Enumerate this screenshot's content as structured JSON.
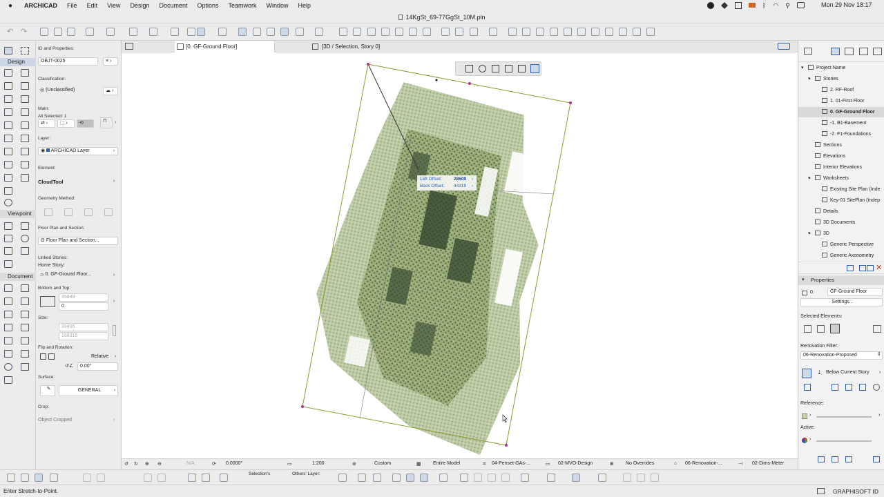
{
  "menubar": {
    "app": "ARCHICAD",
    "items": [
      "File",
      "Edit",
      "View",
      "Design",
      "Document",
      "Options",
      "Teamwork",
      "Window",
      "Help"
    ],
    "datetime": "Mon 29 Nov  18:17"
  },
  "window": {
    "title": "14KgSt_69-77GgSt_10M.pln"
  },
  "tabs": [
    {
      "label": "[0. GF-Ground Floor]"
    },
    {
      "label": "[3D / Selection, Story 0]"
    }
  ],
  "toolbox": {
    "sections": [
      "Design",
      "Viewpoint",
      "Document"
    ]
  },
  "info": {
    "id_label": "ID and Properties:",
    "id_value": "OBJT-0025",
    "classification_label": "Classification:",
    "classification_value": "(Unclassified)",
    "main_label": "Main:",
    "all_selected": "All Selected: 1",
    "layer_label": "Layer:",
    "layer_value": "ARCHICAD Layer",
    "element_label": "Element:",
    "element_value": "CloudTool",
    "geometry_label": "Geometry Method:",
    "floorplan_label": "Floor Plan and Section:",
    "floorplan_value": "Floor Plan and Section...",
    "linked_label": "Linked Stories:",
    "home_label": "Home Story:",
    "home_value": "0. GF-Ground Floor...",
    "bt_label": "Bottom and Top:",
    "bt_top": "35849",
    "bt_bottom": "0",
    "size_label": "Size:",
    "size_w": "99406",
    "size_h": "168315",
    "flip_label": "Flip and Rotation:",
    "relative": "Relative",
    "angle": "0.00°",
    "surface_label": "Surface:",
    "surface_value": "GENERAL",
    "crop_label": "Crop:",
    "crop_value": "Object Cropped"
  },
  "canvas": {
    "tracker_left_label": "Left Offset:",
    "tracker_left_value": "28509",
    "tracker_back_label": "Back Offset:",
    "tracker_back_value": "44319"
  },
  "navigator": {
    "tree": [
      {
        "label": "Project Name",
        "level": 0,
        "expand": "▾"
      },
      {
        "label": "Stories",
        "level": 1,
        "expand": "▾"
      },
      {
        "label": "2. RF-Roof",
        "level": 2,
        "expand": ""
      },
      {
        "label": "1. 01-First Floor",
        "level": 2,
        "expand": ""
      },
      {
        "label": "0. GF-Ground Floor",
        "level": 2,
        "expand": "",
        "selected": true
      },
      {
        "label": "-1. B1-Basement",
        "level": 2,
        "expand": ""
      },
      {
        "label": "-2. F1-Foundations",
        "level": 2,
        "expand": ""
      },
      {
        "label": "Sections",
        "level": 1,
        "expand": ""
      },
      {
        "label": "Elevations",
        "level": 1,
        "expand": ""
      },
      {
        "label": "Interior Elevations",
        "level": 1,
        "expand": ""
      },
      {
        "label": "Worksheets",
        "level": 1,
        "expand": "▾"
      },
      {
        "label": "Existing Site Plan (Inde",
        "level": 2,
        "expand": ""
      },
      {
        "label": "Key-01 SitePlan (Indep",
        "level": 2,
        "expand": ""
      },
      {
        "label": "Details",
        "level": 1,
        "expand": ""
      },
      {
        "label": "3D Documents",
        "level": 1,
        "expand": ""
      },
      {
        "label": "3D",
        "level": 1,
        "expand": "▾"
      },
      {
        "label": "Generic Perspective",
        "level": 2,
        "expand": ""
      },
      {
        "label": "Generic Axonometry",
        "level": 2,
        "expand": ""
      }
    ],
    "properties_title": "Properties",
    "prop_id": "0.",
    "prop_name": "GF-Ground Floor",
    "settings": "Settings...",
    "selected_elements": "Selected Elements:",
    "renovation_label": "Renovation Filter:",
    "renovation_value": "06-Renovation-Proposed",
    "below_story": "Below Current Story",
    "reference_label": "Reference:",
    "active_label": "Active:"
  },
  "bottombar": {
    "na": "N/A",
    "angle": "0.0000°",
    "scale": "1:200",
    "custom": "Custom",
    "model": "Entire Model",
    "penset": "04-Penset-GAs-...",
    "mvo": "02-MVO-Design",
    "overrides": "No Overrides",
    "renovation": "06-Renovation-...",
    "dims": "02-Dims-Meter"
  },
  "toolbar2": {
    "selections": "Selection's",
    "others": "Others' Layer:"
  },
  "statusbar": {
    "hint": "Enter Stretch-to-Point.",
    "brand": "GRAPHISOFT ID"
  },
  "colors": {
    "frame": "#8a9a2c",
    "handle": "#b0308a",
    "selection_bg": "#cfd8e6",
    "accent": "#2f5fb5"
  }
}
